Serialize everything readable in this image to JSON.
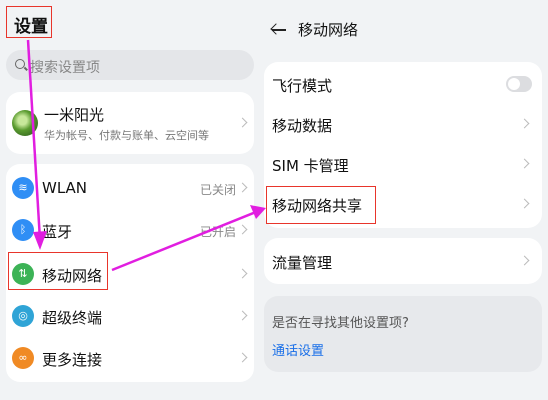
{
  "left_panel": {
    "title": "设置",
    "search_placeholder": "搜索设置项",
    "account": {
      "name": "一米阳光",
      "subtitle": "华为帐号、付款与账单、云空间等"
    },
    "items": [
      {
        "label": "WLAN",
        "value": "已关闭",
        "icon": "wifi-icon"
      },
      {
        "label": "蓝牙",
        "value": "已开启",
        "icon": "bluetooth-icon"
      },
      {
        "label": "移动网络",
        "value": "",
        "icon": "mobile-network-icon"
      },
      {
        "label": "超级终端",
        "value": "",
        "icon": "super-device-icon"
      },
      {
        "label": "更多连接",
        "value": "",
        "icon": "more-connections-icon"
      }
    ]
  },
  "right_panel": {
    "title": "移动网络",
    "items": [
      {
        "label": "飞行模式",
        "control": "toggle-off"
      },
      {
        "label": "移动数据",
        "control": "chevron"
      },
      {
        "label": "SIM 卡管理",
        "control": "chevron"
      },
      {
        "label": "移动网络共享",
        "control": "chevron"
      }
    ],
    "traffic": {
      "label": "流量管理"
    },
    "suggestion": {
      "question": "是否在寻找其他设置项?",
      "link": "通话设置"
    }
  },
  "colors": {
    "annotation_box": "#e8352b",
    "annotation_arrow": "#e11ee0",
    "link": "#1a6fe8"
  }
}
